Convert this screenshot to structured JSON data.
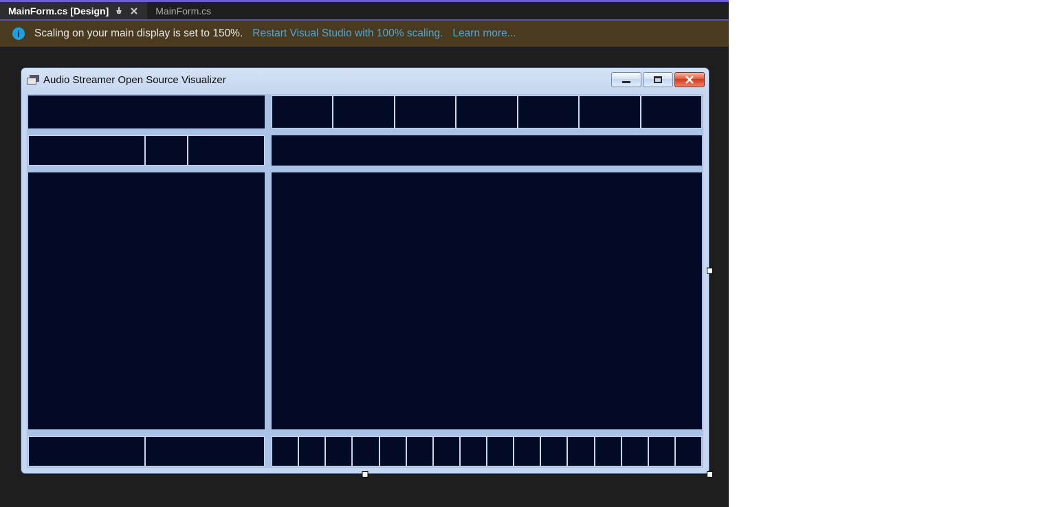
{
  "tabs": {
    "active": {
      "label": "MainForm.cs [Design]"
    },
    "inactive": {
      "label": "MainForm.cs"
    }
  },
  "info_bar": {
    "message": "Scaling on your main display is set to 150%.",
    "restart_link": "Restart Visual Studio with 100% scaling.",
    "learn_link": "Learn more..."
  },
  "form": {
    "title": "Audio Streamer Open Source Visualizer"
  },
  "layout": {
    "row1_right_cells": 7,
    "row4_right_cells": 16
  }
}
